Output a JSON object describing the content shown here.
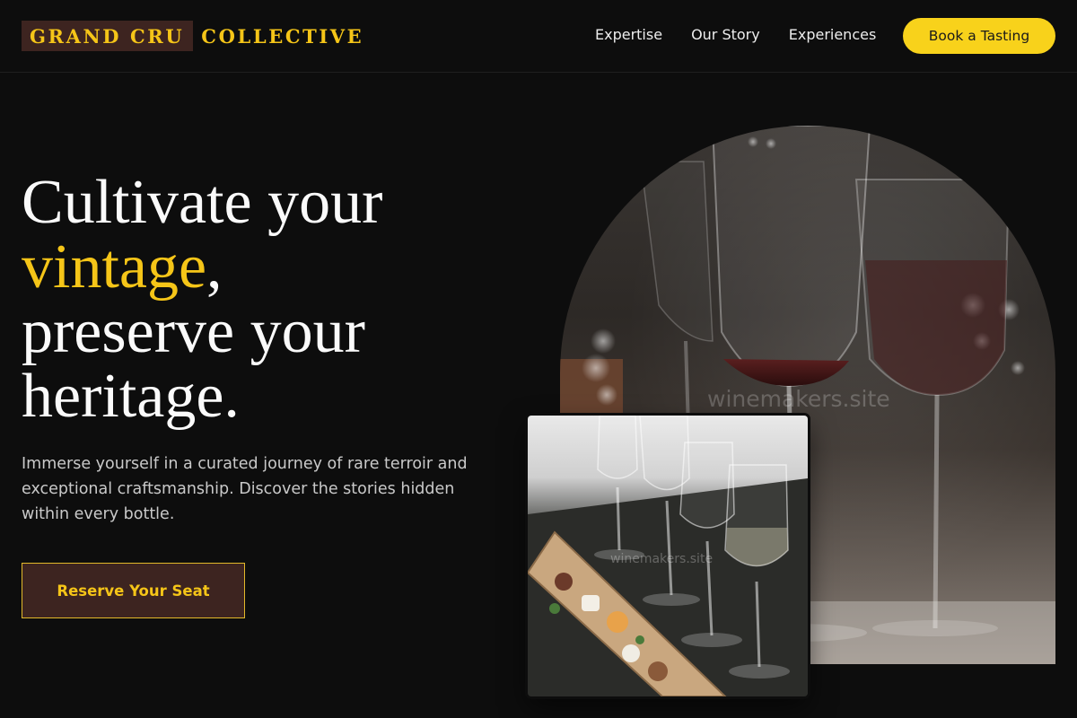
{
  "brand": {
    "name_highlight": "GRAND CRU",
    "name_rest": "COLLECTIVE"
  },
  "nav": {
    "items": [
      "Expertise",
      "Our Story",
      "Experiences"
    ],
    "cta": "Book a Tasting"
  },
  "hero": {
    "line1": "Cultivate your",
    "accent_word": "vintage",
    "accent_punct": ",",
    "line3": "preserve your",
    "line4": "heritage.",
    "subtext": "Immerse yourself in a curated journey of rare terroir and exceptional craftsmanship. Discover the stories hidden within every bottle.",
    "cta": "Reserve Your Seat"
  },
  "images": {
    "main_watermark": "winemakers.site",
    "inset_watermark": "winemakers.site",
    "main_icon": "wine-glasses-photo",
    "inset_icon": "tasting-board-photo"
  },
  "colors": {
    "background": "#0d0d0d",
    "accent": "#f5c518",
    "logo_box": "#3d2420",
    "button_yellow": "#f8d21b"
  }
}
